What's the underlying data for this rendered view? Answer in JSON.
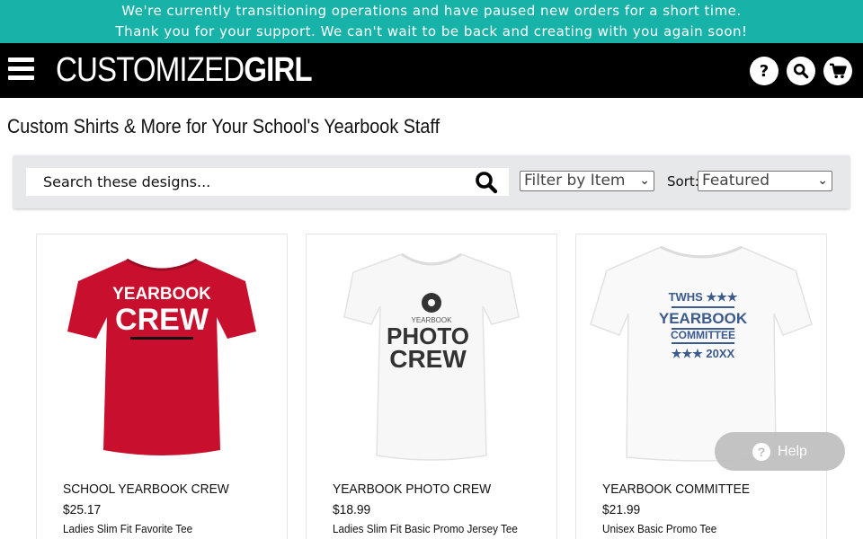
{
  "banner": {
    "line1": "We're currently transitioning operations and have paused new orders for a short time.",
    "line2": "Thank you for your support. We can't wait to be back and creating with you again soon!",
    "color": "#17b3a8"
  },
  "header": {
    "logo_light": "CUSTOMIZED",
    "logo_bold": "GIRL",
    "icons": [
      "menu-icon",
      "help-icon",
      "search-icon",
      "cart-icon"
    ]
  },
  "page": {
    "title": "Custom Shirts & More for Your School's Yearbook Staff"
  },
  "toolbar": {
    "search_placeholder": "Search these designs...",
    "filter_value": "Filter by Item",
    "sort_label": "Sort:",
    "sort_value": "Featured"
  },
  "products": [
    {
      "name": "SCHOOL YEARBOOK CREW",
      "price": "$25.17",
      "description": "Ladies Slim Fit Favorite Tee",
      "shirt_color": "#c8102e",
      "print": [
        "YEARBOOK",
        "CREW"
      ]
    },
    {
      "name": "YEARBOOK PHOTO CREW",
      "price": "$18.99",
      "description": "Ladies Slim Fit Basic Promo Jersey Tee",
      "shirt_color": "#ffffff",
      "print": [
        "YEARBOOK",
        "PHOTO",
        "CREW"
      ]
    },
    {
      "name": "YEARBOOK COMMITTEE",
      "price": "$21.99",
      "description": "Unisex Basic Promo Tee",
      "shirt_color": "#ffffff",
      "print": [
        "TWHS ★★★",
        "YEARBOOK",
        "COMMITTEE",
        "★★★ 20XX"
      ]
    }
  ],
  "help_widget": {
    "label": "Help"
  }
}
